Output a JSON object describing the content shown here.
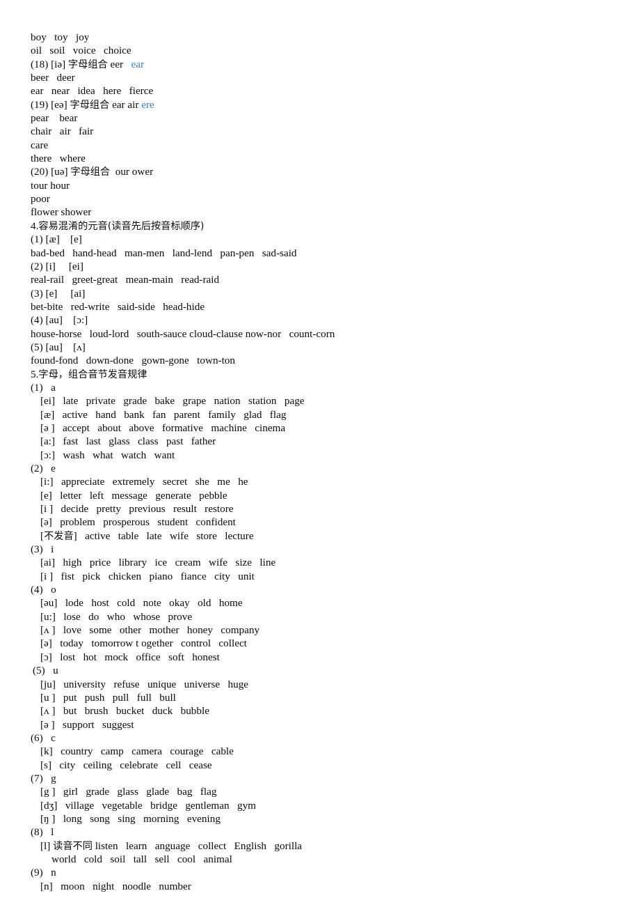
{
  "document": {
    "type": "english-phonetics-study-notes",
    "page_background": "#ffffff",
    "text_color": "#0a0a0a",
    "link_color": "#3d7fc1"
  },
  "lines": [
    {
      "id": "l01",
      "indent": 0,
      "segments": [
        {
          "text": "boy   toy   joy"
        }
      ]
    },
    {
      "id": "l02",
      "indent": 0,
      "segments": [
        {
          "text": "oil   soil   voice   choice"
        }
      ]
    },
    {
      "id": "l03",
      "indent": 0,
      "segments": [
        {
          "text": "(18) [iə] "
        },
        {
          "text": "字母组合",
          "cn": true
        },
        {
          "text": " eer   "
        },
        {
          "text": "ear",
          "blue": true
        }
      ]
    },
    {
      "id": "l04",
      "indent": 0,
      "segments": [
        {
          "text": "beer   deer"
        }
      ]
    },
    {
      "id": "l05",
      "indent": 0,
      "segments": [
        {
          "text": "ear   near   idea   here   fierce"
        }
      ]
    },
    {
      "id": "l06",
      "indent": 0,
      "segments": [
        {
          "text": "(19) [eə] "
        },
        {
          "text": "字母组合",
          "cn": true
        },
        {
          "text": " ear air "
        },
        {
          "text": "ere",
          "blue": true
        }
      ]
    },
    {
      "id": "l07",
      "indent": 0,
      "segments": [
        {
          "text": "pear    bear"
        }
      ]
    },
    {
      "id": "l08",
      "indent": 0,
      "segments": [
        {
          "text": "chair   air   fair"
        }
      ]
    },
    {
      "id": "l09",
      "indent": 0,
      "segments": [
        {
          "text": "care"
        }
      ]
    },
    {
      "id": "l10",
      "indent": 0,
      "segments": [
        {
          "text": "there   where"
        }
      ]
    },
    {
      "id": "l11",
      "indent": 0,
      "segments": [
        {
          "text": "(20) [uə] "
        },
        {
          "text": "字母组合",
          "cn": true
        },
        {
          "text": "  our ower"
        }
      ]
    },
    {
      "id": "l12",
      "indent": 0,
      "segments": [
        {
          "text": "tour hour"
        }
      ]
    },
    {
      "id": "l13",
      "indent": 0,
      "segments": [
        {
          "text": "poor"
        }
      ]
    },
    {
      "id": "l14",
      "indent": 0,
      "segments": [
        {
          "text": "flower shower"
        }
      ]
    },
    {
      "id": "l15",
      "indent": 0,
      "segments": [
        {
          "text": "4."
        },
        {
          "text": "容易混淆的元音(读音先后按音标顺序)",
          "cn": true
        }
      ]
    },
    {
      "id": "l16",
      "indent": 0,
      "segments": [
        {
          "text": "(1) [æ]    [e]"
        }
      ]
    },
    {
      "id": "l17",
      "indent": 0,
      "segments": [
        {
          "text": "bad-bed   hand-head   man-men   land-lend   pan-pen   sad-said"
        }
      ]
    },
    {
      "id": "l18",
      "indent": 0,
      "segments": [
        {
          "text": "(2) [i]     [ei]"
        }
      ]
    },
    {
      "id": "l19",
      "indent": 0,
      "segments": [
        {
          "text": "real-rail   greet-great   mean-main   read-raid"
        }
      ]
    },
    {
      "id": "l20",
      "indent": 0,
      "segments": [
        {
          "text": "(3) [e]     [ai]"
        }
      ]
    },
    {
      "id": "l21",
      "indent": 0,
      "segments": [
        {
          "text": "bet-bite   red-write   said-side   head-hide"
        }
      ]
    },
    {
      "id": "l22",
      "indent": 0,
      "segments": [
        {
          "text": "(4) [au]    [ɔ:]"
        }
      ]
    },
    {
      "id": "l23",
      "indent": 0,
      "segments": [
        {
          "text": "house-horse   loud-lord   south-sauce cloud-clause now-nor   count-corn"
        }
      ]
    },
    {
      "id": "l24",
      "indent": 0,
      "segments": [
        {
          "text": "(5) [au]    [ʌ]"
        }
      ]
    },
    {
      "id": "l25",
      "indent": 0,
      "segments": [
        {
          "text": "found-fond   down-done   gown-gone   town-ton"
        }
      ]
    },
    {
      "id": "l26",
      "indent": 0,
      "segments": [
        {
          "text": "5."
        },
        {
          "text": "字母，组合音节发音规律",
          "cn": true
        }
      ]
    },
    {
      "id": "l27",
      "indent": 0,
      "segments": [
        {
          "text": "(1)   a"
        }
      ]
    },
    {
      "id": "l28",
      "indent": 2,
      "segments": [
        {
          "text": "[ei]   late   private   grade   bake   grape   nation   station   page"
        }
      ]
    },
    {
      "id": "l29",
      "indent": 2,
      "segments": [
        {
          "text": "[æ]   active   hand   bank   fan   parent   family   glad   flag"
        }
      ]
    },
    {
      "id": "l30",
      "indent": 2,
      "segments": [
        {
          "text": "[ə ]   accept   about   above   formative   machine   cinema"
        }
      ]
    },
    {
      "id": "l31",
      "indent": 2,
      "segments": [
        {
          "text": "[a:]   fast   last   glass   class   past   father"
        }
      ]
    },
    {
      "id": "l32",
      "indent": 2,
      "segments": [
        {
          "text": "[ɔ:]   wash   what   watch   want"
        }
      ]
    },
    {
      "id": "l33",
      "indent": 0,
      "segments": [
        {
          "text": "(2)   e"
        }
      ]
    },
    {
      "id": "l34",
      "indent": 2,
      "segments": [
        {
          "text": "[i:]   appreciate   extremely   secret   she   me   he"
        }
      ]
    },
    {
      "id": "l35",
      "indent": 2,
      "segments": [
        {
          "text": "[e]   letter   left   message   generate   pebble"
        }
      ]
    },
    {
      "id": "l36",
      "indent": 2,
      "segments": [
        {
          "text": "[i ]   decide   pretty   previous   result   restore"
        }
      ]
    },
    {
      "id": "l37",
      "indent": 2,
      "segments": [
        {
          "text": "[ə]   problem   prosperous   student   confident"
        }
      ]
    },
    {
      "id": "l38",
      "indent": 2,
      "segments": [
        {
          "text": "["
        },
        {
          "text": "不发音",
          "cn": true
        },
        {
          "text": "]   active   table   late   wife   store   lecture"
        }
      ]
    },
    {
      "id": "l39",
      "indent": 0,
      "segments": [
        {
          "text": "(3)   i"
        }
      ]
    },
    {
      "id": "l40",
      "indent": 2,
      "segments": [
        {
          "text": "[ai]   high   price   library   ice   cream   wife   size   line"
        }
      ]
    },
    {
      "id": "l41",
      "indent": 2,
      "segments": [
        {
          "text": "[i ]   fist   pick   chicken   piano   fiance   city   unit"
        }
      ]
    },
    {
      "id": "l42",
      "indent": 0,
      "segments": [
        {
          "text": "(4)   o"
        }
      ]
    },
    {
      "id": "l43",
      "indent": 2,
      "segments": [
        {
          "text": "[əu]   lode   host   cold   note   okay   old   home"
        }
      ]
    },
    {
      "id": "l44",
      "indent": 2,
      "segments": [
        {
          "text": "[u:]   lose   do   who   whose   prove"
        }
      ]
    },
    {
      "id": "l45",
      "indent": 2,
      "segments": [
        {
          "text": "[ʌ ]   love   some   other   mother   honey   company"
        }
      ]
    },
    {
      "id": "l46",
      "indent": 2,
      "segments": [
        {
          "text": "[ə]   today   tomorrow t ogether   control   collect"
        }
      ]
    },
    {
      "id": "l47",
      "indent": 2,
      "segments": [
        {
          "text": "[ɔ]   lost   hot   mock   office   soft   honest"
        }
      ]
    },
    {
      "id": "l48",
      "indent": 1,
      "segments": [
        {
          "text": "(5)   u"
        }
      ]
    },
    {
      "id": "l49",
      "indent": 2,
      "segments": [
        {
          "text": "[ju]   university   refuse   unique   universe   huge"
        }
      ]
    },
    {
      "id": "l50",
      "indent": 2,
      "segments": [
        {
          "text": "[u ]   put   push   pull   full   bull"
        }
      ]
    },
    {
      "id": "l51",
      "indent": 2,
      "segments": [
        {
          "text": "[ʌ ]   but   brush   bucket   duck   bubble"
        }
      ]
    },
    {
      "id": "l52",
      "indent": 2,
      "segments": [
        {
          "text": "[ə ]   support   suggest"
        }
      ]
    },
    {
      "id": "l53",
      "indent": 0,
      "segments": [
        {
          "text": "(6)   c"
        }
      ]
    },
    {
      "id": "l54",
      "indent": 2,
      "segments": [
        {
          "text": "[k]   country   camp   camera   courage   cable"
        }
      ]
    },
    {
      "id": "l55",
      "indent": 2,
      "segments": [
        {
          "text": "[s]   city   ceiling   celebrate   cell   cease"
        }
      ]
    },
    {
      "id": "l56",
      "indent": 0,
      "segments": [
        {
          "text": "(7)   g"
        }
      ]
    },
    {
      "id": "l57",
      "indent": 2,
      "segments": [
        {
          "text": "[g ]   girl   grade   glass   glade   bag   flag"
        }
      ]
    },
    {
      "id": "l58",
      "indent": 2,
      "segments": [
        {
          "text": "[dʒ]   village   vegetable   bridge   gentleman   gym"
        }
      ]
    },
    {
      "id": "l59",
      "indent": 2,
      "segments": [
        {
          "text": "[ŋ ]   long   song   sing   morning   evening"
        }
      ]
    },
    {
      "id": "l60",
      "indent": 0,
      "segments": [
        {
          "text": "(8)   l"
        }
      ]
    },
    {
      "id": "l61",
      "indent": 2,
      "segments": [
        {
          "text": "[l] "
        },
        {
          "text": "读音不同",
          "cn": true
        },
        {
          "text": " listen   learn   anguage   collect   English   gorilla"
        }
      ]
    },
    {
      "id": "l62",
      "indent": 4,
      "segments": [
        {
          "text": "world   cold   soil   tall   sell   cool   animal"
        }
      ]
    },
    {
      "id": "l63",
      "indent": 0,
      "segments": [
        {
          "text": "(9)   n"
        }
      ]
    },
    {
      "id": "l64",
      "indent": 2,
      "segments": [
        {
          "text": "[n]   moon   night   noodle   number"
        }
      ]
    }
  ]
}
